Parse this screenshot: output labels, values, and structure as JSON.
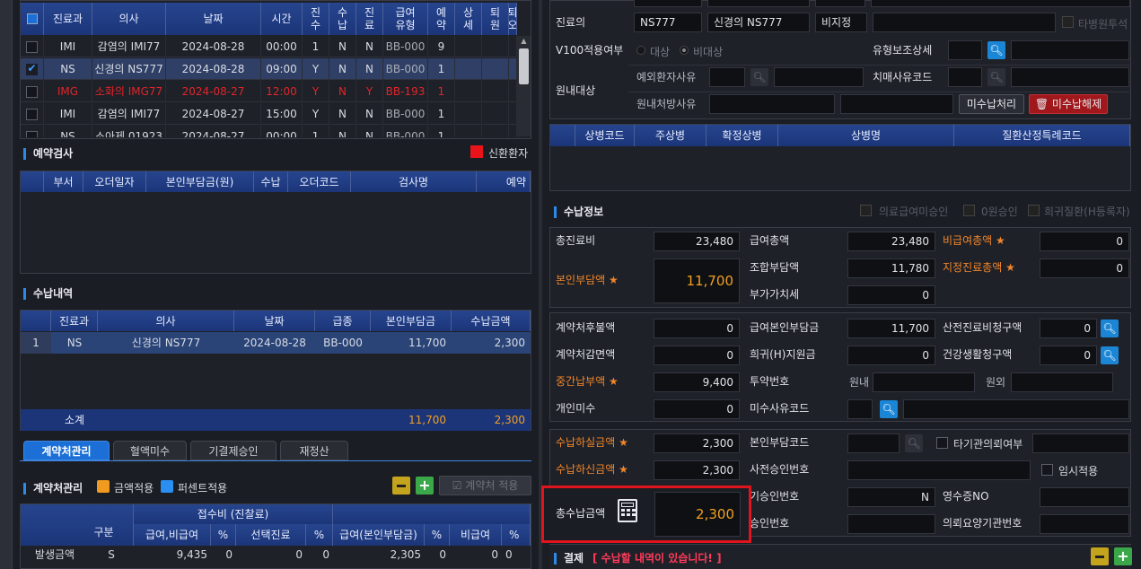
{
  "left": {
    "reservation_table": {
      "headers": [
        "진료과",
        "의사",
        "날짜",
        "시간",
        "진\n수",
        "수\n납",
        "진\n료",
        "급여\n유형",
        "예\n약",
        "상\n세",
        "퇴\n원",
        "퇴\n오"
      ],
      "rows": [
        {
          "dept": "IMI",
          "doctor": "감염의 IMI77",
          "date": "2024-08-28",
          "time": "00:00",
          "jin": "1",
          "sunap": "N",
          "jinryo": "N",
          "type": "BB-000",
          "ye": "9",
          "checked": false,
          "red": false
        },
        {
          "dept": "NS",
          "doctor": "신경의 NS777",
          "date": "2024-08-28",
          "time": "09:00",
          "jin": "Y",
          "sunap": "N",
          "jinryo": "N",
          "type": "BB-000",
          "ye": "1",
          "checked": true,
          "red": false
        },
        {
          "dept": "IMG",
          "doctor": "소화의 IMG77",
          "date": "2024-08-27",
          "time": "12:00",
          "jin": "Y",
          "sunap": "N",
          "jinryo": "Y",
          "type": "BB-193",
          "ye": "1",
          "checked": false,
          "red": true
        },
        {
          "dept": "IMI",
          "doctor": "감염의 IMI77",
          "date": "2024-08-27",
          "time": "15:00",
          "jin": "Y",
          "sunap": "N",
          "jinryo": "N",
          "type": "BB-000",
          "ye": "1",
          "checked": false,
          "red": false
        },
        {
          "dept": "NS",
          "doctor": "소아제 01923",
          "date": "2024-08-27",
          "time": "00:00",
          "jin": "1",
          "sunap": "N",
          "jinryo": "N",
          "type": "BB-000",
          "ye": "1",
          "checked": false,
          "red": false
        }
      ]
    },
    "exam": {
      "title": "예약검사",
      "new_patient": "신환환자",
      "headers": [
        "부서",
        "오더일자",
        "본인부담금(원)",
        "수납",
        "오더코드",
        "검사명",
        "예약"
      ]
    },
    "payment_history": {
      "title": "수납내역",
      "headers": [
        "진료과",
        "의사",
        "날짜",
        "급종",
        "본인부담금",
        "수납금액"
      ],
      "row": {
        "no": "1",
        "dept": "NS",
        "doctor": "신경의 NS777",
        "date": "2024-08-28",
        "type": "BB-000",
        "self": "11,700",
        "paid": "2,300"
      },
      "subtotal": {
        "label": "소계",
        "self": "11,700",
        "paid": "2,300"
      }
    },
    "tabs": [
      "계약처관리",
      "혈액미수",
      "기결제승인",
      "재정산"
    ],
    "contract": {
      "title": "계약처관리",
      "amount_apply": "금액적용",
      "percent_apply": "퍼센트적용",
      "apply_btn": "계약처 적용",
      "group_header": "접수비 (진찰료)",
      "col_gubun": "구분",
      "subheaders": [
        "급여,비급여",
        "%",
        "선택진료",
        "%",
        "급여(본인부담금)",
        "%",
        "비급여",
        "%"
      ],
      "row": {
        "label": "발생금액",
        "gubun": "S",
        "v1": "9,435",
        "p1": "0",
        "v2": "0",
        "p2": "0",
        "v3": "2,305",
        "p3": "0",
        "v4": "0",
        "p4": "0"
      }
    }
  },
  "right": {
    "jinryoui_label": "진료의",
    "jinryoui_code": "NS777",
    "jinryoui_name": "신경의 NS777",
    "bijijeong": "비지정",
    "other_hospital": "타병원투석",
    "v100_label": "V100적용여부",
    "v100_opt1": "대상",
    "v100_opt2": "비대상",
    "yuhyung_label": "유형보조상세",
    "wonnae_label": "원내대상",
    "exception_label": "예외환자사유",
    "dementia_label": "치매사유코드",
    "wonnae_rx_label": "원내처방사유",
    "unpaid_btn": "미수납처리",
    "unpaid_cancel_btn": "미수납해제",
    "disease_headers": [
      "상병코드",
      "주상병",
      "확정상병",
      "상병명",
      "질환산정특례코드"
    ],
    "payinfo": {
      "title": "수납정보",
      "opt1": "의료급여미승인",
      "opt2": "0원승인",
      "opt3": "희귀질환(H등록자)",
      "total_label": "총진료비",
      "total": "23,480",
      "benefit_total_label": "급여총액",
      "benefit_total": "23,480",
      "nonbenefit_label": "비급여총액",
      "nonbenefit": "0",
      "self_label": "본인부담액",
      "self": "11,700",
      "union_label": "조합부담액",
      "union": "11,780",
      "designated_label": "지정진료총액",
      "designated": "0",
      "vat_label": "부가가치세",
      "vat": "0",
      "contract_after_label": "계약처후불액",
      "contract_after": "0",
      "benefit_self_label": "급여본인부담금",
      "benefit_self": "11,700",
      "industrial_label": "산전진료비청구액",
      "industrial": "0",
      "contract_reduce_label": "계약처감면액",
      "contract_reduce": "0",
      "rare_label": "희귀(H)지원금",
      "rare": "0",
      "health_label": "건강생활청구액",
      "health": "0",
      "mid_label": "중간납부액",
      "mid": "9,400",
      "drug_label": "투약번호",
      "wonnae": "원내",
      "wonoe": "원외",
      "personal_label": "개인미수",
      "personal": "0",
      "unpaid_code_label": "미수사유코드",
      "actual_label": "수납하실금액",
      "actual": "2,300",
      "self_code_label": "본인부담코드",
      "other_inst_label": "타기관의뢰여부",
      "new_label": "수납하신금액",
      "new": "2,300",
      "pre_approval_label": "사전승인번호",
      "temp_label": "임시적용",
      "total_pay_label": "총수납금액",
      "total_pay": "2,300",
      "approval_label": "기승인번호",
      "approval_val": "N",
      "receipt_label": "영수증NO",
      "approval2_label": "승인번호",
      "referral_label": "의뢰요양기관번호"
    },
    "payment": {
      "title": "결제",
      "warning": "[ 수납할 내역이 있습니다! ]"
    }
  }
}
